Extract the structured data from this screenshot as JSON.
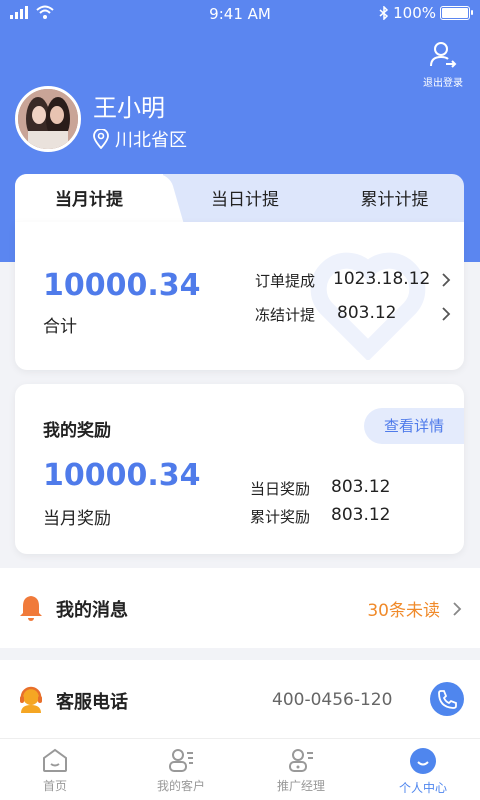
{
  "status_bar": {
    "time": "9:41 AM",
    "battery": "100%"
  },
  "header": {
    "logout_label": "退出登录",
    "username": "王小明",
    "location": "川北省区"
  },
  "tabs": [
    {
      "label": "当月计提"
    },
    {
      "label": "当日计提"
    },
    {
      "label": "累计计提"
    }
  ],
  "commission": {
    "total_value": "10000.34",
    "total_label": "合计",
    "rows": [
      {
        "label": "订单提成",
        "value": "1023.18.12"
      },
      {
        "label": "冻结计提",
        "value": "803.12"
      }
    ]
  },
  "rewards": {
    "title": "我的奖励",
    "detail_button": "查看详情",
    "total_value": "10000.34",
    "total_label": "当月奖励",
    "rows": [
      {
        "label": "当日奖励",
        "value": "803.12"
      },
      {
        "label": "累计奖励",
        "value": "803.12"
      }
    ]
  },
  "messages": {
    "label": "我的消息",
    "unread": "30条未读"
  },
  "service": {
    "label": "客服电话",
    "phone": "400-0456-120"
  },
  "tabbar": [
    {
      "label": "首页"
    },
    {
      "label": "我的客户"
    },
    {
      "label": "推广经理"
    },
    {
      "label": "个人中心"
    }
  ],
  "colors": {
    "primary": "#5b86f0",
    "accent_blue": "#4f7bea",
    "unread_orange": "#f08a2a"
  }
}
